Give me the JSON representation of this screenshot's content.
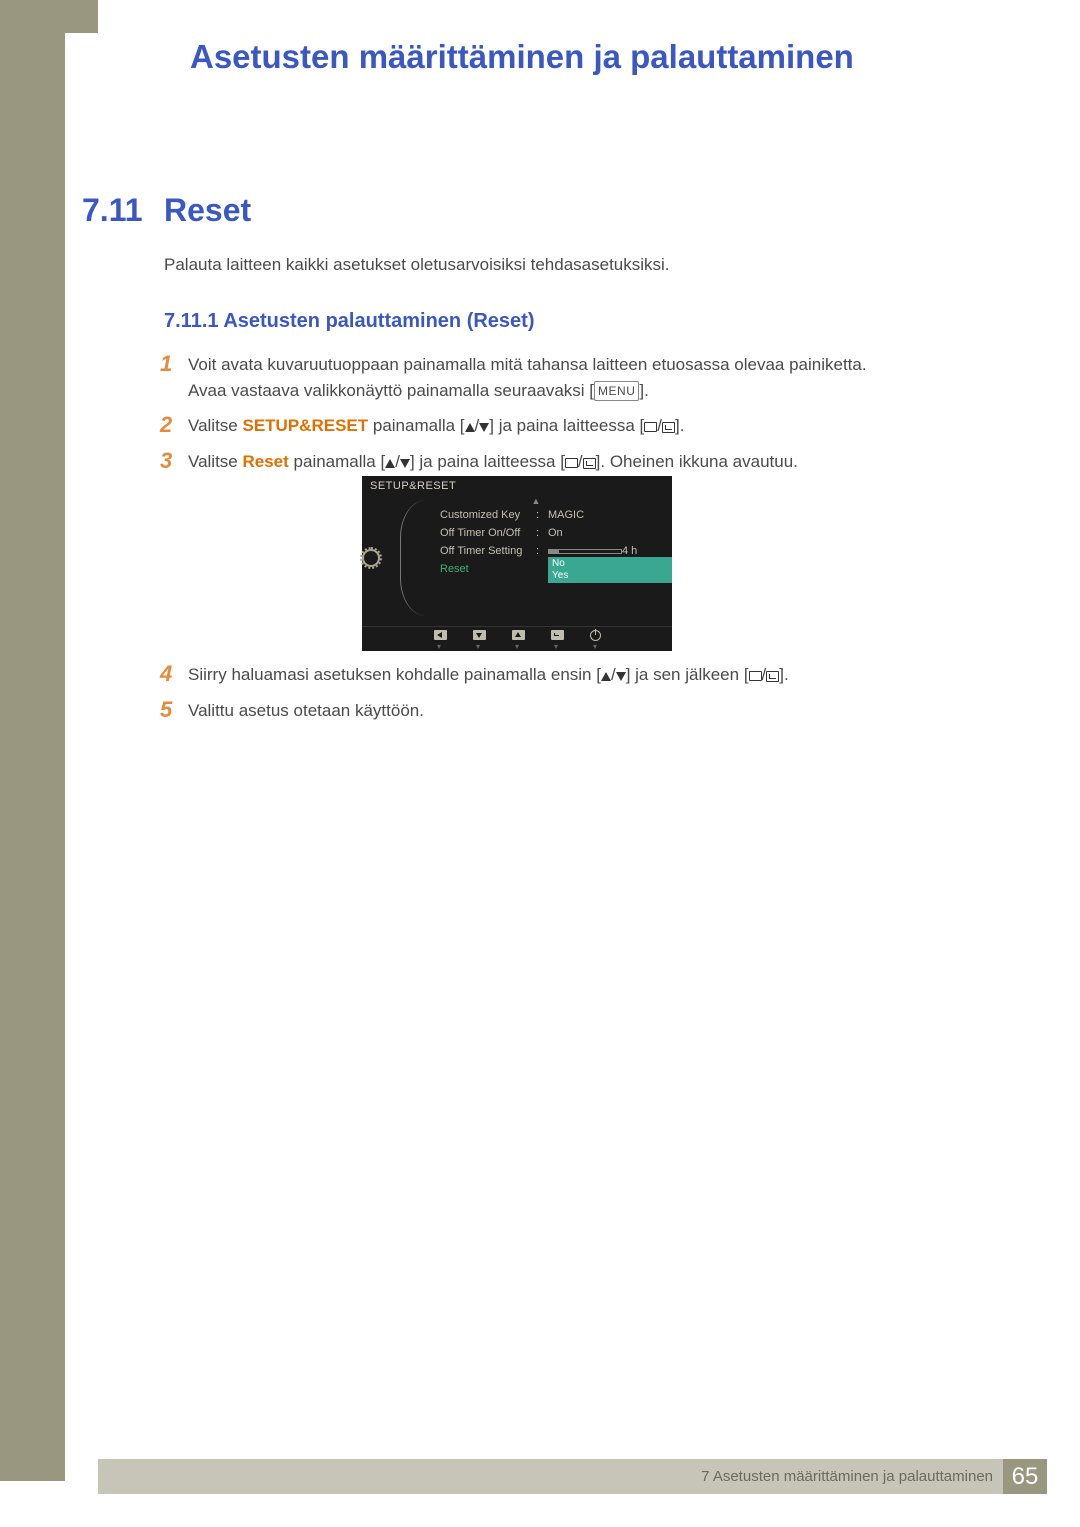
{
  "chapter_title": "Asetusten määrittäminen ja palauttaminen",
  "section": {
    "number": "7.11",
    "title": "Reset"
  },
  "intro": "Palauta laitteen kaikki asetukset oletusarvoisiksi tehdasasetuksiksi.",
  "subsection": "7.11.1   Asetusten palauttaminen (Reset)",
  "steps": {
    "s1a": "Voit avata kuvaruutuoppaan painamalla mitä tahansa laitteen etuosassa olevaa painiketta. Avaa vastaava valikkonäyttö painamalla seuraavaksi [",
    "s1b": "].",
    "menu_key": "MENU",
    "s2a": "Valitse ",
    "s2hl": "SETUP&RESET",
    "s2b": " painamalla [",
    "s2c": "] ja paina laitteessa [",
    "s2d": "].",
    "s3a": "Valitse ",
    "s3hl": "Reset",
    "s3b": " painamalla [",
    "s3c": "] ja paina laitteessa [",
    "s3d": "]. Oheinen ikkuna avautuu.",
    "s4a": "Siirry haluamasi asetuksen kohdalle painamalla ensin [",
    "s4b": "] ja sen jälkeen [",
    "s4c": "].",
    "s5": "Valittu asetus otetaan käyttöön."
  },
  "osd": {
    "title": "SETUP&RESET",
    "rows": {
      "r1": {
        "label": "Customized Key",
        "value": "MAGIC"
      },
      "r2": {
        "label": "Off Timer On/Off",
        "value": "On"
      },
      "r3": {
        "label": "Off Timer Setting",
        "value": "4 h"
      },
      "r4": {
        "label": "Reset",
        "opt1": "No",
        "opt2": "Yes"
      }
    }
  },
  "footer": {
    "text": "7 Asetusten määrittäminen ja palauttaminen",
    "page": "65"
  }
}
